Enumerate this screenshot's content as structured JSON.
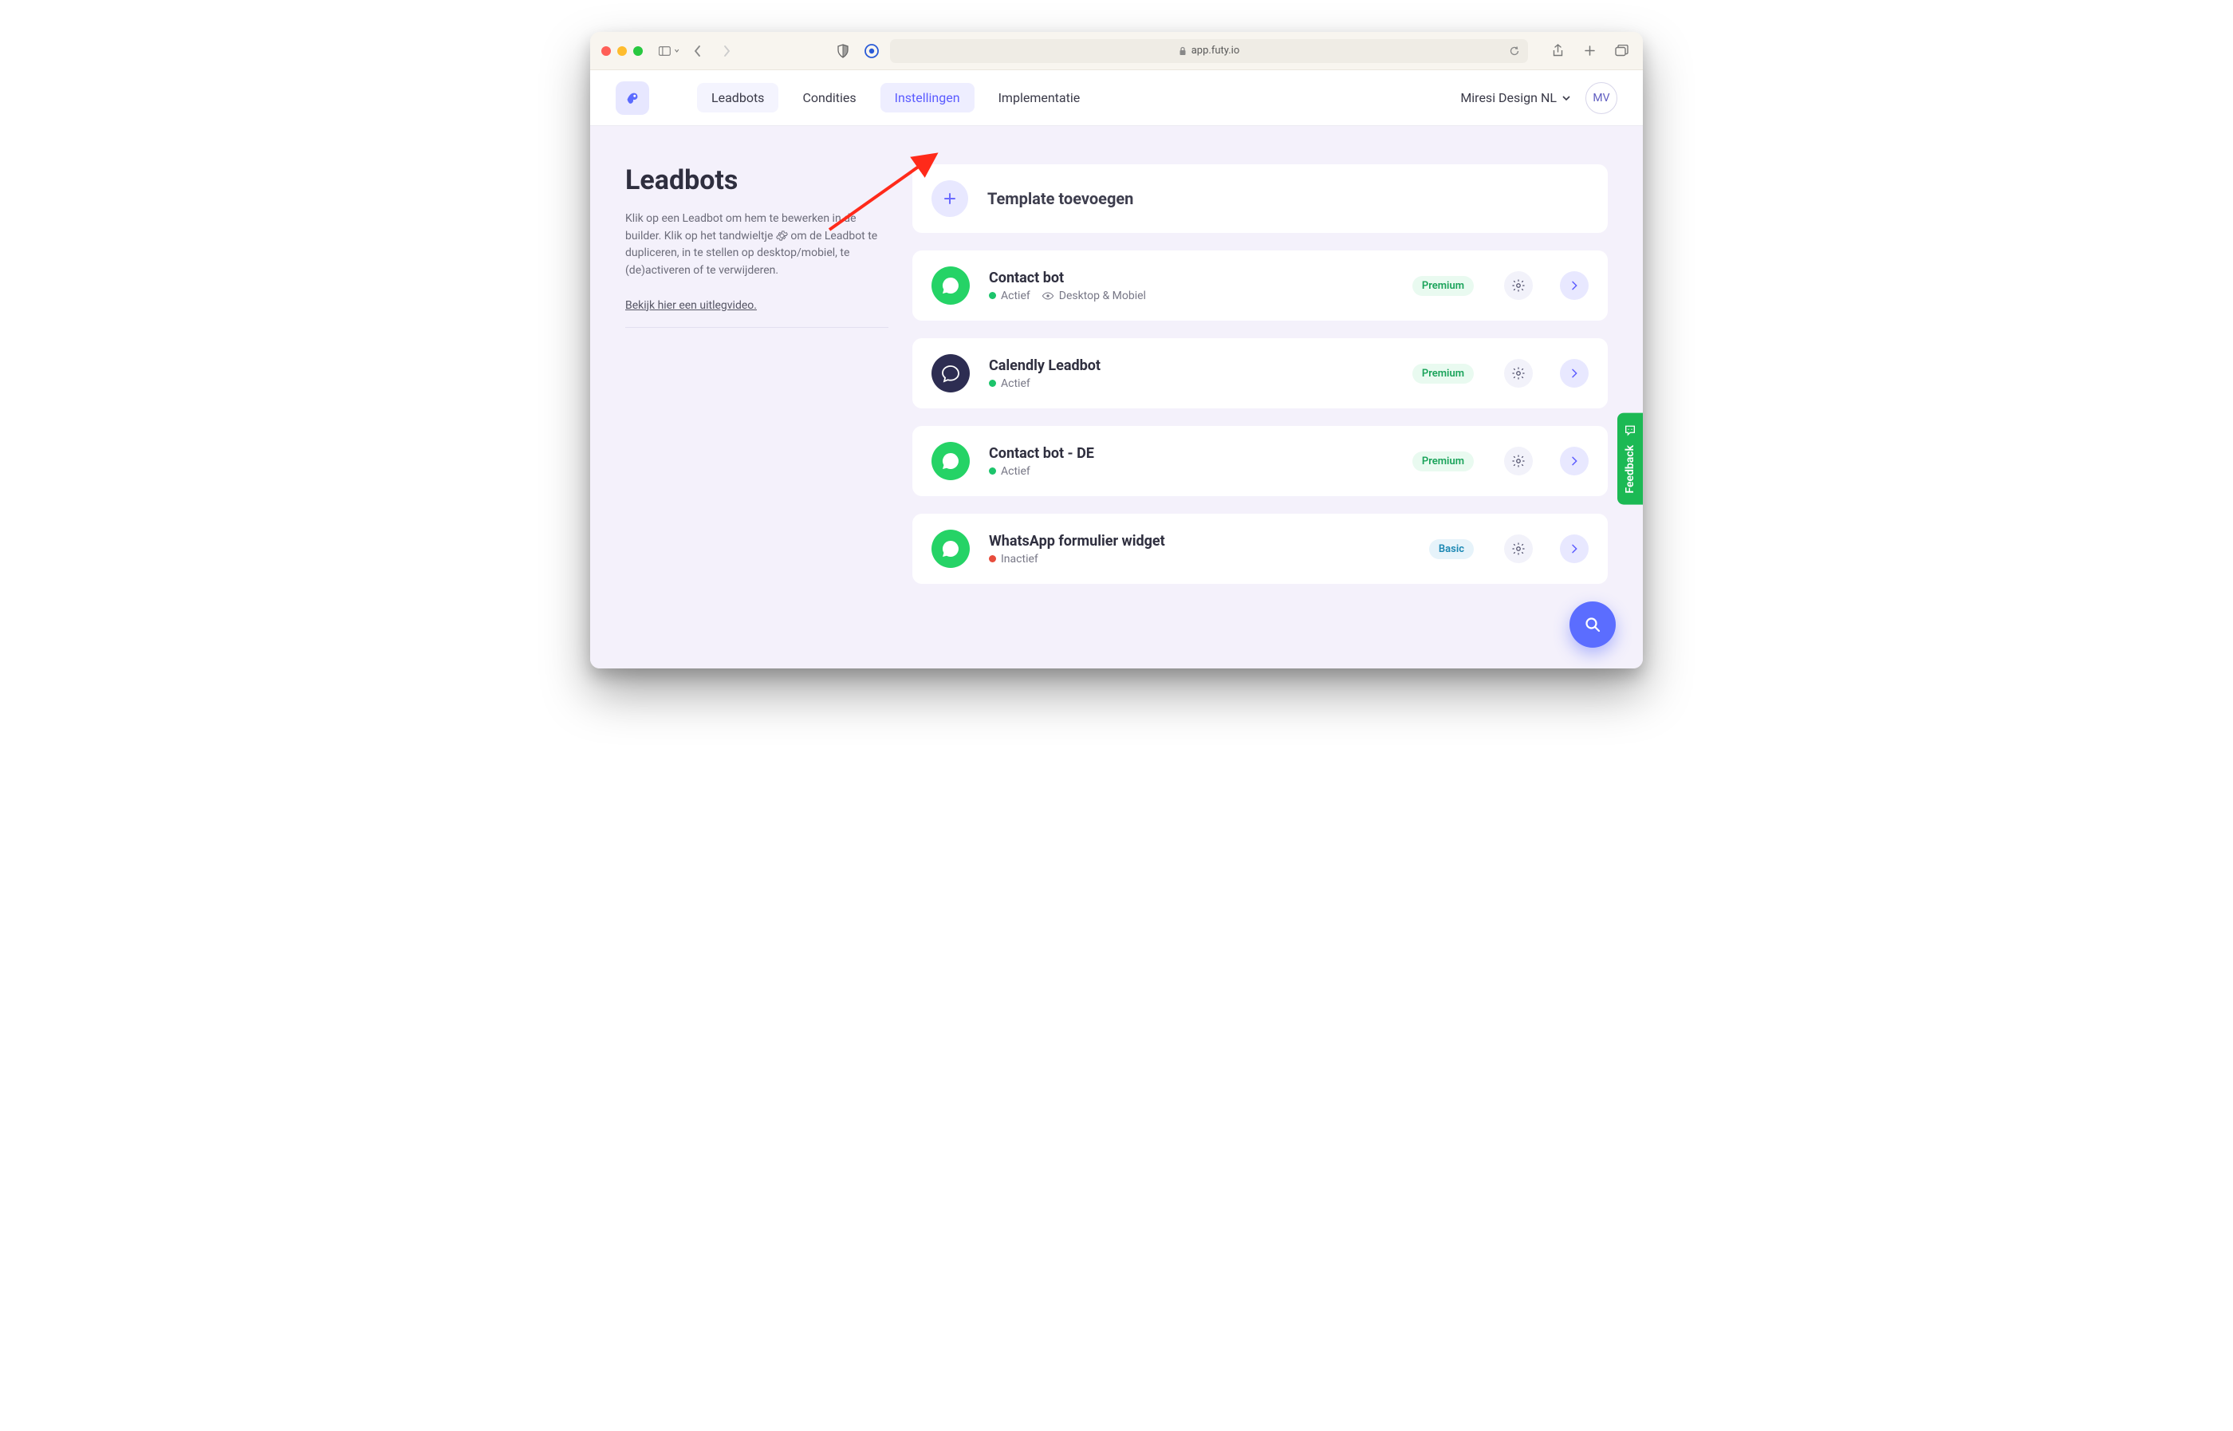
{
  "browser": {
    "url": "app.futy.io"
  },
  "nav": {
    "items": [
      {
        "label": "Leadbots"
      },
      {
        "label": "Condities"
      },
      {
        "label": "Instellingen"
      },
      {
        "label": "Implementatie"
      }
    ]
  },
  "account": {
    "name": "Miresi Design NL",
    "initials": "MV"
  },
  "page": {
    "title": "Leadbots",
    "description_before": "Klik op een Leadbot om hem te bewerken in de builder. Klik op het tandwieltje ",
    "description_after": " om de Leadbot te dupliceren, in te stellen op desktop/mobiel, te (de)activeren of te verwijderen.",
    "video_link": "Bekijk hier een uitlegvideo."
  },
  "add_template": {
    "label": "Template toevoegen"
  },
  "bots": [
    {
      "name": "Contact bot",
      "icon": "whatsapp",
      "icon_bg": "green",
      "status": "Actief",
      "status_ok": true,
      "visibility": "Desktop & Mobiel",
      "show_visibility": true,
      "badge": "Premium",
      "badge_kind": "premium"
    },
    {
      "name": "Calendly Leadbot",
      "icon": "chat",
      "icon_bg": "navy",
      "status": "Actief",
      "status_ok": true,
      "show_visibility": false,
      "badge": "Premium",
      "badge_kind": "premium"
    },
    {
      "name": "Contact bot - DE",
      "icon": "whatsapp",
      "icon_bg": "green",
      "status": "Actief",
      "status_ok": true,
      "show_visibility": false,
      "badge": "Premium",
      "badge_kind": "premium"
    },
    {
      "name": "WhatsApp formulier widget",
      "icon": "whatsapp",
      "icon_bg": "green",
      "status": "Inactief",
      "status_ok": false,
      "show_visibility": false,
      "badge": "Basic",
      "badge_kind": "basic"
    }
  ],
  "feedback_label": "Feedback"
}
